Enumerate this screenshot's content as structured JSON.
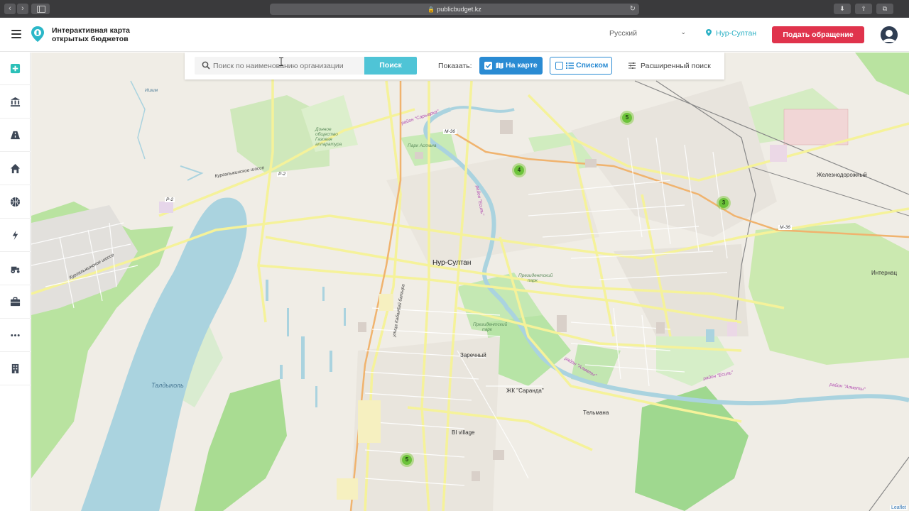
{
  "browser": {
    "url": "publicbudget.kz",
    "nav_back": "‹",
    "nav_forward": "›"
  },
  "header": {
    "title": "Интерактивная карта открытых бюджетов",
    "language": "Русский",
    "city": "Нур-Султан",
    "submit_label": "Подать обращение"
  },
  "sidebar": {
    "items": [
      {
        "icon": "plus-square-icon"
      },
      {
        "icon": "bank-icon"
      },
      {
        "icon": "road-icon"
      },
      {
        "icon": "home-icon"
      },
      {
        "icon": "basketball-icon"
      },
      {
        "icon": "lightning-icon"
      },
      {
        "icon": "tractor-icon"
      },
      {
        "icon": "briefcase-icon"
      },
      {
        "icon": "more-dots-icon"
      },
      {
        "icon": "building-icon"
      }
    ]
  },
  "toolbar": {
    "search_placeholder": "Поиск по наименованию организации",
    "search_button": "Поиск",
    "show_label": "Показать:",
    "map_view_label": "На карте",
    "map_view_checked": true,
    "list_view_label": "Списком",
    "list_view_checked": false,
    "advanced_search": "Расширенный поиск"
  },
  "map": {
    "city_label": "Нур-Султан",
    "labels": {
      "zhelez": "Железнодорожный",
      "zarechny": "Заречный",
      "saranda": "ЖК \"Саранда\"",
      "telmana": "Тельмана",
      "bi_village": "BI village",
      "taldykol": "Талдыколь",
      "internat": "Интернац",
      "prez_park_1": "Президентский парк",
      "prez_park_2": "Президентский парк",
      "park_astana": "Парк Астана",
      "donnoe": "Донное общество Газовая аппаратура",
      "saryarka": "район \"Сарыарка\"",
      "esil": "район \"Есиль\"",
      "almaty": "район \"Алматы\"",
      "almaty2": "район \"Алматы\"",
      "esil2": "район \"Есиль\"",
      "m36_a": "M-36",
      "m36_b": "M-36",
      "p2_a": "P-2",
      "p2_b": "P-2",
      "kurgal1": "Кургальжинское шоссе",
      "kurgal2": "Кургальжинское шоссе",
      "kabanbai": "улица Кабанбай батыра",
      "ishim": "Ишим"
    },
    "clusters": [
      {
        "count": "5"
      },
      {
        "count": "4"
      },
      {
        "count": "3"
      },
      {
        "count": "5"
      }
    ],
    "attribution": "Leaflet",
    "colors": {
      "water": "#aad3df",
      "park": "#c8e8b0",
      "forest": "#9fd88f",
      "road_major": "#f7f7a8",
      "road_orange": "#f0b36e",
      "cluster": "#6cc33a"
    }
  },
  "colors": {
    "accent": "#2a8bd3",
    "search_button": "#4fc4d6",
    "submit_button": "#e0334c",
    "city_link": "#2bb0c4"
  }
}
